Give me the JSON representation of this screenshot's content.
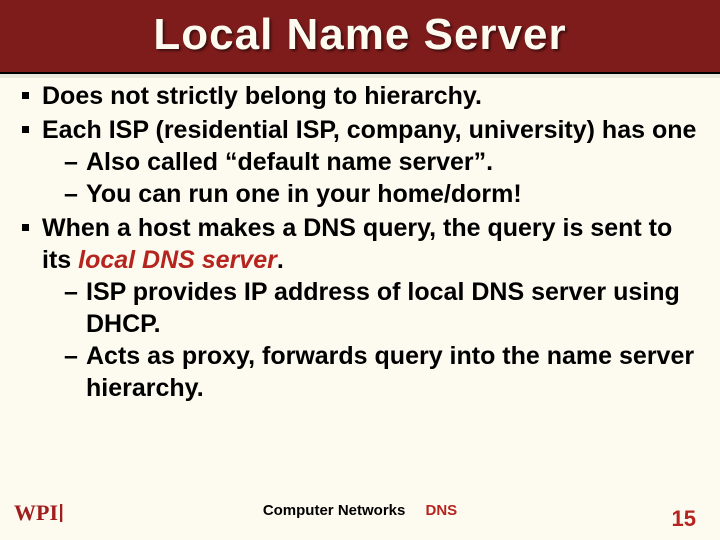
{
  "title": "Local Name Server",
  "bullets": [
    {
      "text": "Does not strictly belong to hierarchy."
    },
    {
      "text": "Each ISP (residential ISP, company, university) has one",
      "sub": [
        "Also called “default name server”.",
        "You can run one in your home/dorm!"
      ]
    },
    {
      "text_pre": "When a host makes  a DNS query, the query is sent to its ",
      "text_emph": "local DNS server",
      "text_post": ".",
      "sub": [
        "ISP provides IP address of local DNS server using DHCP.",
        "Acts as proxy, forwards query into the name server hierarchy."
      ]
    }
  ],
  "footer": {
    "course": "Computer Networks",
    "topic": "DNS"
  },
  "page_number": "15",
  "logo_text": "WPI"
}
